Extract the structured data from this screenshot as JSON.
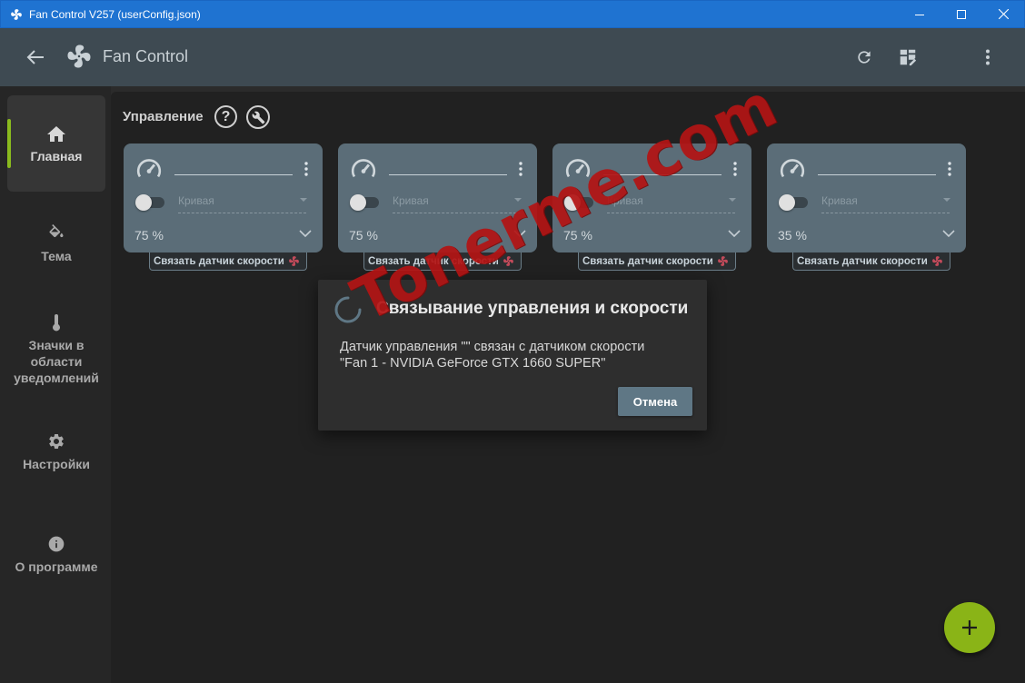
{
  "window": {
    "title": "Fan Control V257 (userConfig.json)",
    "icons": [
      "fan-icon",
      "minimize-icon",
      "maximize-icon",
      "close-icon"
    ]
  },
  "appbar": {
    "title": "Fan Control",
    "icons": [
      "back-arrow-icon",
      "fan-logo-icon",
      "refresh-icon",
      "dashboard-edit-icon",
      "more-vert-icon"
    ]
  },
  "sidebar": {
    "items": [
      {
        "label": "Главная",
        "icon": "home-icon",
        "active": true
      },
      {
        "label": "Тема",
        "icon": "paint-bucket-icon",
        "active": false
      },
      {
        "label": "Значки в области уведомлений",
        "icon": "thermometer-icon",
        "active": false
      },
      {
        "label": "Настройки",
        "icon": "gear-icon",
        "active": false
      },
      {
        "label": "О программе",
        "icon": "info-icon",
        "active": false
      }
    ],
    "accent_color": "#8aba1e"
  },
  "main": {
    "section_title": "Управление",
    "help_label": "?",
    "cards": [
      {
        "name": "",
        "curve_placeholder": "Кривая",
        "percent": "75 %",
        "link_label": "Связать датчик скорости",
        "enabled": false
      },
      {
        "name": "",
        "curve_placeholder": "Кривая",
        "percent": "75 %",
        "link_label": "Связать датчик скорости",
        "enabled": false
      },
      {
        "name": "",
        "curve_placeholder": "Кривая",
        "percent": "75 %",
        "link_label": "Связать датчик скорости",
        "enabled": false
      },
      {
        "name": "",
        "curve_placeholder": "Кривая",
        "percent": "35 %",
        "link_label": "Связать датчик скорости",
        "enabled": false
      }
    ]
  },
  "dialog": {
    "title": "Связывание управления и скорости",
    "message_line1": "Датчик управления \"\" связан с датчиком скорости",
    "message_line2": "\"Fan 1 - NVIDIA GeForce GTX 1660 SUPER\"",
    "cancel_label": "Отмена"
  },
  "watermark": {
    "text": "Tonerme.com",
    "color": "#b31414"
  },
  "fab": {
    "label": "+",
    "color": "#8ab417"
  }
}
